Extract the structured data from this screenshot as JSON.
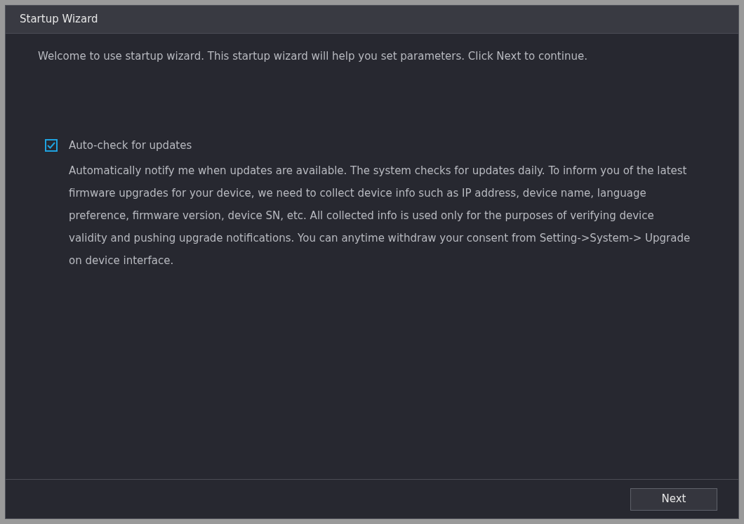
{
  "window": {
    "title": "Startup Wizard"
  },
  "intro": "Welcome to use startup wizard. This startup wizard will help you set parameters. Click Next to continue.",
  "auto_check": {
    "label": "Auto-check for updates",
    "checked": true,
    "description": "Automatically notify me when updates are available. The system checks for updates daily. To inform you of the latest firmware upgrades for your device, we need to collect device info such as IP address, device name, language preference, firmware version, device SN, etc. All collected info is used only for the purposes of verifying device validity and pushing upgrade notifications. You can anytime withdraw your consent from Setting->System-> Upgrade on device interface."
  },
  "buttons": [
    "Next"
  ]
}
